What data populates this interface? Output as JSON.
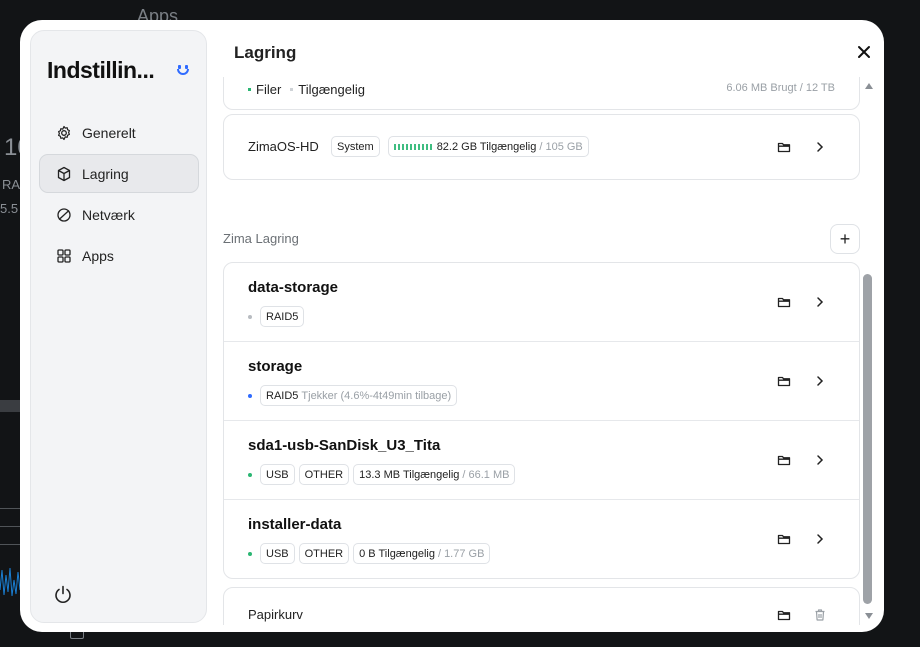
{
  "background": {
    "app_title": "Apps",
    "fragments": [
      "10",
      "RA",
      "5.5"
    ]
  },
  "sidebar": {
    "title": "Indstillin...",
    "items": [
      {
        "label": "Generelt",
        "icon": "gear-icon"
      },
      {
        "label": "Lagring",
        "icon": "cube-icon",
        "active": true
      },
      {
        "label": "Netværk",
        "icon": "network-icon"
      },
      {
        "label": "Apps",
        "icon": "grid-icon"
      }
    ]
  },
  "header": {
    "title": "Lagring"
  },
  "top_card": {
    "legend_files": "Filer",
    "legend_available": "Tilgængelig",
    "used_text": "6.06 MB Brugt / 12 TB"
  },
  "system_drive": {
    "name": "ZimaOS-HD",
    "tag": "System",
    "available": "82.2 GB Tilgængelig",
    "total": "/ 105 GB"
  },
  "zima_section": {
    "title": "Zima Lagring",
    "pools": [
      {
        "name": "data-storage",
        "status_color": "#b8bcc1",
        "tags": [
          "RAID5"
        ],
        "extra": ""
      },
      {
        "name": "storage",
        "status_color": "#2f6bff",
        "tags": [
          "RAID5"
        ],
        "extra": "Tjekker (4.6%-4t49min tilbage)"
      },
      {
        "name": "sda1-usb-SanDisk_U3_Tita",
        "status_color": "#2bb673",
        "tags": [
          "USB",
          "OTHER"
        ],
        "available": "13.3 MB Tilgængelig",
        "total": "/ 66.1 MB"
      },
      {
        "name": "installer-data",
        "status_color": "#2bb673",
        "tags": [
          "USB",
          "OTHER"
        ],
        "available": "0 B Tilgængelig",
        "total": "/ 1.77 GB"
      }
    ]
  },
  "trash": {
    "label": "Papirkurv"
  },
  "colors": {
    "accent": "#2f6bff",
    "ok": "#2bb673"
  }
}
